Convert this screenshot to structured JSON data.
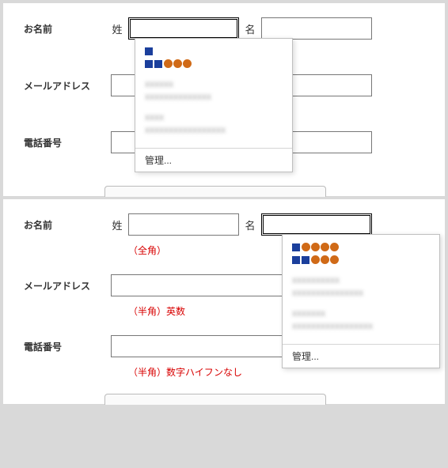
{
  "panel1": {
    "name_label": "お名前",
    "surname_label": "姓",
    "given_label": "名",
    "email_label": "メールアドレス",
    "phone_label": "電話番号"
  },
  "panel2": {
    "name_label": "お名前",
    "surname_label": "姓",
    "given_label": "名",
    "helper_name": "（全角）",
    "email_label": "メールアドレス",
    "helper_email": "（半角）英数",
    "phone_label": "電話番号",
    "helper_phone": "（半角）数字ハイフンなし"
  },
  "autofill1": {
    "manage": "管理..."
  },
  "autofill2": {
    "manage": "管理..."
  }
}
